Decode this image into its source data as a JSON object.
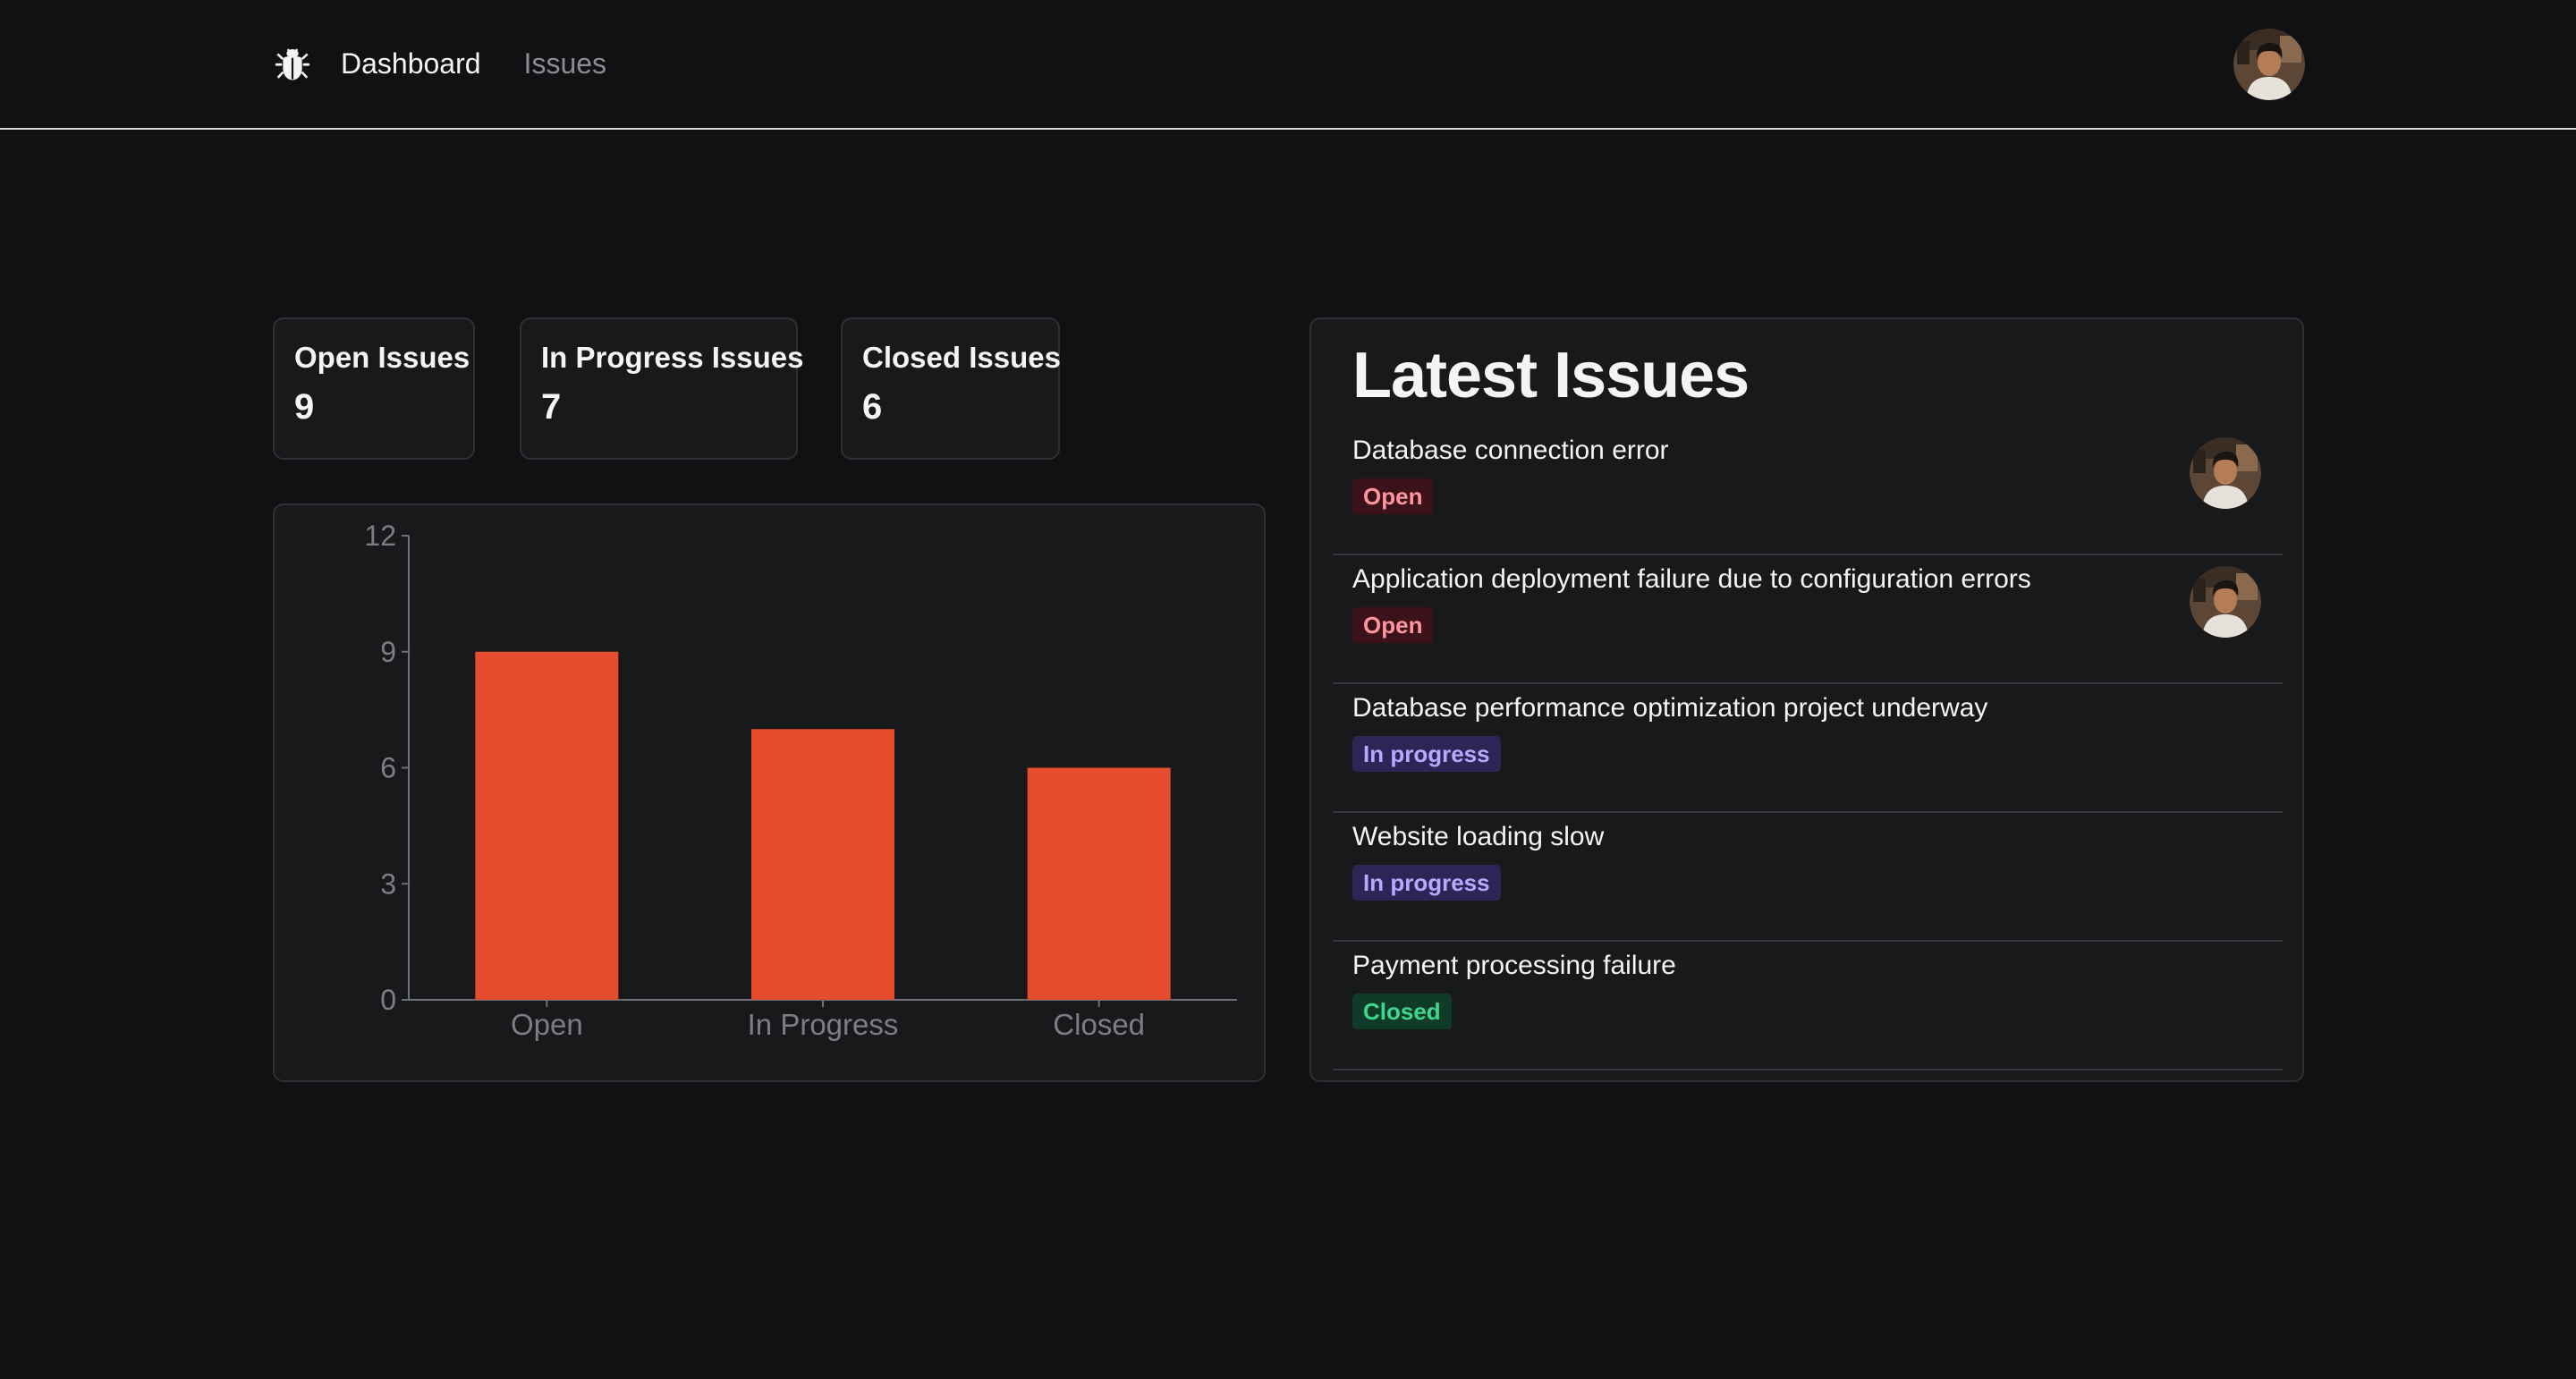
{
  "nav": {
    "logo_icon": "bug-icon",
    "dashboard_label": "Dashboard",
    "issues_label": "Issues",
    "user_avatar": "user-avatar"
  },
  "stats": [
    {
      "label": "Open Issues",
      "value": "9"
    },
    {
      "label": "In Progress Issues",
      "value": "7"
    },
    {
      "label": "Closed Issues",
      "value": "6"
    }
  ],
  "chart_data": {
    "type": "bar",
    "categories": [
      "Open",
      "In Progress",
      "Closed"
    ],
    "values": [
      9,
      7,
      6
    ],
    "ylim": [
      0,
      12
    ],
    "yticks": [
      "0",
      "3",
      "6",
      "9",
      "12"
    ],
    "bar_color": "#e54d2e",
    "grid": false
  },
  "latest": {
    "title": "Latest Issues",
    "issues": [
      {
        "title": "Database connection error",
        "status": "Open",
        "has_avatar": true
      },
      {
        "title": "Application deployment failure due to configuration errors",
        "status": "Open",
        "has_avatar": true
      },
      {
        "title": "Database performance optimization project underway",
        "status": "In progress",
        "has_avatar": false
      },
      {
        "title": "Website loading slow",
        "status": "In progress",
        "has_avatar": false
      },
      {
        "title": "Payment processing failure",
        "status": "Closed",
        "has_avatar": false
      }
    ]
  },
  "colors": {
    "background": "#111113",
    "card": "#18191b",
    "bar": "#e54d2e",
    "open_badge_bg": "#3b1219",
    "open_badge_text": "#ff949d",
    "progress_badge_bg": "#2e2557",
    "progress_badge_text": "#baa7ff",
    "closed_badge_bg": "#113b29",
    "closed_badge_text": "#3dd68c"
  }
}
